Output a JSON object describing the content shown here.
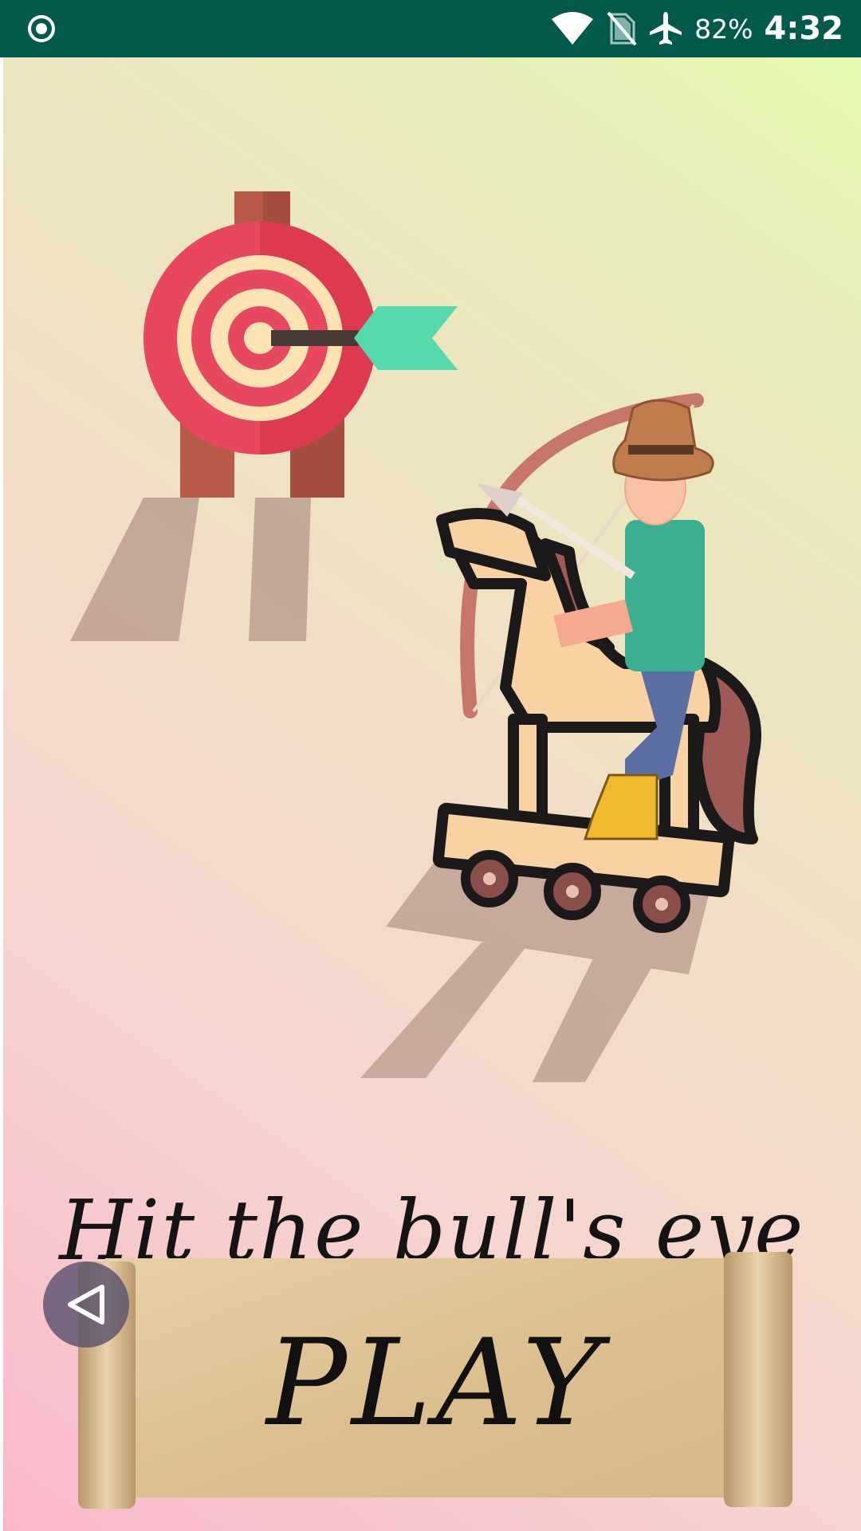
{
  "status_bar": {
    "battery": "82%",
    "time": "4:32",
    "icons": [
      "target-icon",
      "wifi-icon",
      "no-sim-icon",
      "airplane-icon"
    ]
  },
  "game": {
    "title": "Hit the bull's eye",
    "play_label": "PLAY",
    "illustration": [
      "archery-target",
      "arrow",
      "cowboy-archer",
      "rocking-horse"
    ]
  },
  "nav": {
    "back_icon": "back-triangle-icon"
  },
  "colors": {
    "status_bar": "#035a4c",
    "target_red": "#e8485f",
    "target_cream": "#fbe3b3",
    "fletching": "#55d9ab",
    "horse": "#f9d2a3",
    "shirt": "#3cae92",
    "jeans": "#5b6fa3",
    "boots": "#f0b930"
  }
}
